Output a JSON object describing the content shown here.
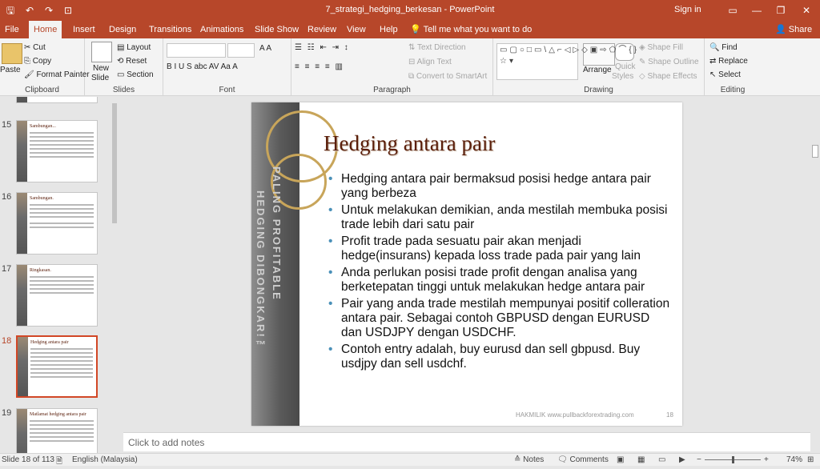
{
  "window": {
    "title": "7_strategi_hedging_berkesan - PowerPoint",
    "signin": "Sign in",
    "min_icon": "minimize-icon",
    "restore_icon": "restore-icon",
    "close_icon": "close-icon"
  },
  "qat": {
    "save_icon": "save-icon",
    "undo_icon": "undo-icon",
    "redo_icon": "redo-icon",
    "present_icon": "slideshow-icon"
  },
  "tabs": [
    {
      "label": "File"
    },
    {
      "label": "Home"
    },
    {
      "label": "Insert"
    },
    {
      "label": "Design"
    },
    {
      "label": "Transitions"
    },
    {
      "label": "Animations"
    },
    {
      "label": "Slide Show"
    },
    {
      "label": "Review"
    },
    {
      "label": "View"
    },
    {
      "label": "Help"
    }
  ],
  "tell_me": "Tell me what you want to do",
  "share": "Share",
  "ribbon": {
    "clipboard": {
      "label": "Clipboard",
      "paste": "Paste",
      "cut": "Cut",
      "copy": "Copy",
      "format_painter": "Format Painter"
    },
    "slides": {
      "label": "Slides",
      "new_slide": "New",
      "new_slide2": "Slide",
      "layout": "Layout",
      "reset": "Reset",
      "section": "Section"
    },
    "font": {
      "label": "Font",
      "format_buttons": "B I U S abc AV Aa A"
    },
    "paragraph": {
      "label": "Paragraph",
      "text_direction": "Text Direction",
      "align_text": "Align Text",
      "smartart": "Convert to SmartArt"
    },
    "drawing": {
      "label": "Drawing",
      "shapes_glyphs": "▭▢○□▭\\△⌐◁▷◇▣⇨⬠⌒{}☆▾",
      "arrange": "Arrange",
      "quick_styles1": "Quick",
      "quick_styles2": "Styles",
      "shape_fill": "Shape Fill",
      "shape_outline": "Shape Outline",
      "shape_effects": "Shape Effects"
    },
    "editing": {
      "label": "Editing",
      "find": "Find",
      "replace": "Replace",
      "select": "Select"
    }
  },
  "thumbnails": [
    {
      "num": "15",
      "title": "Sambungan..."
    },
    {
      "num": "16",
      "title": "Sambungan."
    },
    {
      "num": "17",
      "title": "Ringkasan."
    },
    {
      "num": "18",
      "title": "Hedging antara pair"
    },
    {
      "num": "19",
      "title": "Matlamat hedging antara pair"
    }
  ],
  "slide": {
    "title": "Hedging antara pair",
    "side_text_1": "HEDGING DIBONGKAR!™",
    "side_text_2": "PALING PROFITABLE",
    "bullets": [
      "Hedging antara pair bermaksud posisi hedge antara pair yang berbeza",
      "Untuk melakukan demikian, anda mestilah membuka posisi trade lebih dari satu pair",
      "Profit trade pada sesuatu pair akan menjadi hedge(insurans) kepada loss trade pada pair yang lain",
      "Anda perlukan posisi trade profit dengan analisa yang berketepatan tinggi untuk melakukan hedge antara pair",
      "Pair yang anda trade mestilah mempunyai positif colleration antara pair. Sebagai contoh GBPUSD dengan EURUSD dan USDJPY dengan USDCHF.",
      "Contoh entry adalah, buy eurusd dan sell gbpusd. Buy usdjpy dan sell usdchf."
    ],
    "footer": "HAKMILIK www.pullbackforextrading.com",
    "page": "18"
  },
  "notes_placeholder": "Click to add notes",
  "status": {
    "slide_of": "Slide 18 of 113",
    "language": "English (Malaysia)",
    "notes": "Notes",
    "comments": "Comments",
    "zoom": "74%",
    "zoom_minus": "−",
    "zoom_plus": "+"
  }
}
